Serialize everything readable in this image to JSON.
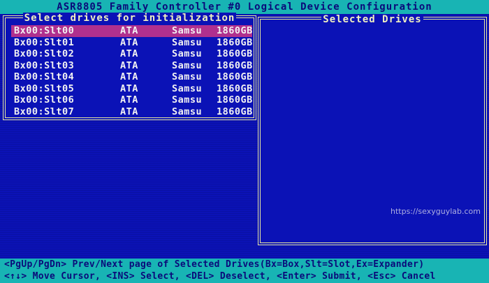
{
  "title": "ASR8805 Family Controller #0 Logical Device Configuration",
  "left_panel": {
    "title": "Select drives for initialization",
    "drives": [
      {
        "id": "Bx00:Slt00",
        "type": "ATA",
        "vendor": "Samsu",
        "size": "1860GB"
      },
      {
        "id": "Bx00:Slt01",
        "type": "ATA",
        "vendor": "Samsu",
        "size": "1860GB"
      },
      {
        "id": "Bx00:Slt02",
        "type": "ATA",
        "vendor": "Samsu",
        "size": "1860GB"
      },
      {
        "id": "Bx00:Slt03",
        "type": "ATA",
        "vendor": "Samsu",
        "size": "1860GB"
      },
      {
        "id": "Bx00:Slt04",
        "type": "ATA",
        "vendor": "Samsu",
        "size": "1860GB"
      },
      {
        "id": "Bx00:Slt05",
        "type": "ATA",
        "vendor": "Samsu",
        "size": "1860GB"
      },
      {
        "id": "Bx00:Slt06",
        "type": "ATA",
        "vendor": "Samsu",
        "size": "1860GB"
      },
      {
        "id": "Bx00:Slt07",
        "type": "ATA",
        "vendor": "Samsu",
        "size": "1860GB"
      }
    ],
    "selected_index": 0
  },
  "right_panel": {
    "title": "Selected Drives"
  },
  "watermark": "https://sexyguylab.com",
  "status": {
    "line1": "<PgUp/PgDn> Prev/Next page of Selected Drives(Bx=Box,Slt=Slot,Ex=Expander)",
    "line2": "<↑↓> Move Cursor, <INS> Select, <DEL> Deselect, <Enter> Submit, <Esc> Cancel"
  },
  "colors": {
    "background": "#0b12b6",
    "bar": "#18b4b4",
    "highlight": "#b0308e",
    "border": "#e8e8a0"
  }
}
